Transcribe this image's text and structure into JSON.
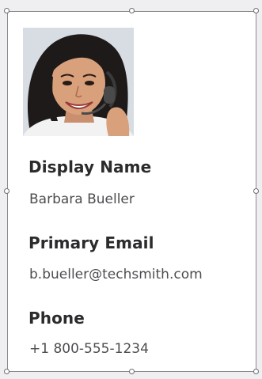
{
  "contact_card": {
    "display_name_label": "Display Name",
    "display_name_value": "Barbara Bueller",
    "primary_email_label": "Primary Email",
    "primary_email_value": "b.bueller@techsmith.com",
    "phone_label": "Phone",
    "phone_value": "+1 800-555-1234"
  },
  "colors": {
    "label_text": "#2b2b2e",
    "value_text": "#4d4d52",
    "frame": "#8a8a8e",
    "page_background": "#efeff1"
  },
  "icons": {
    "selection_handle": "circle-handle-icon"
  }
}
